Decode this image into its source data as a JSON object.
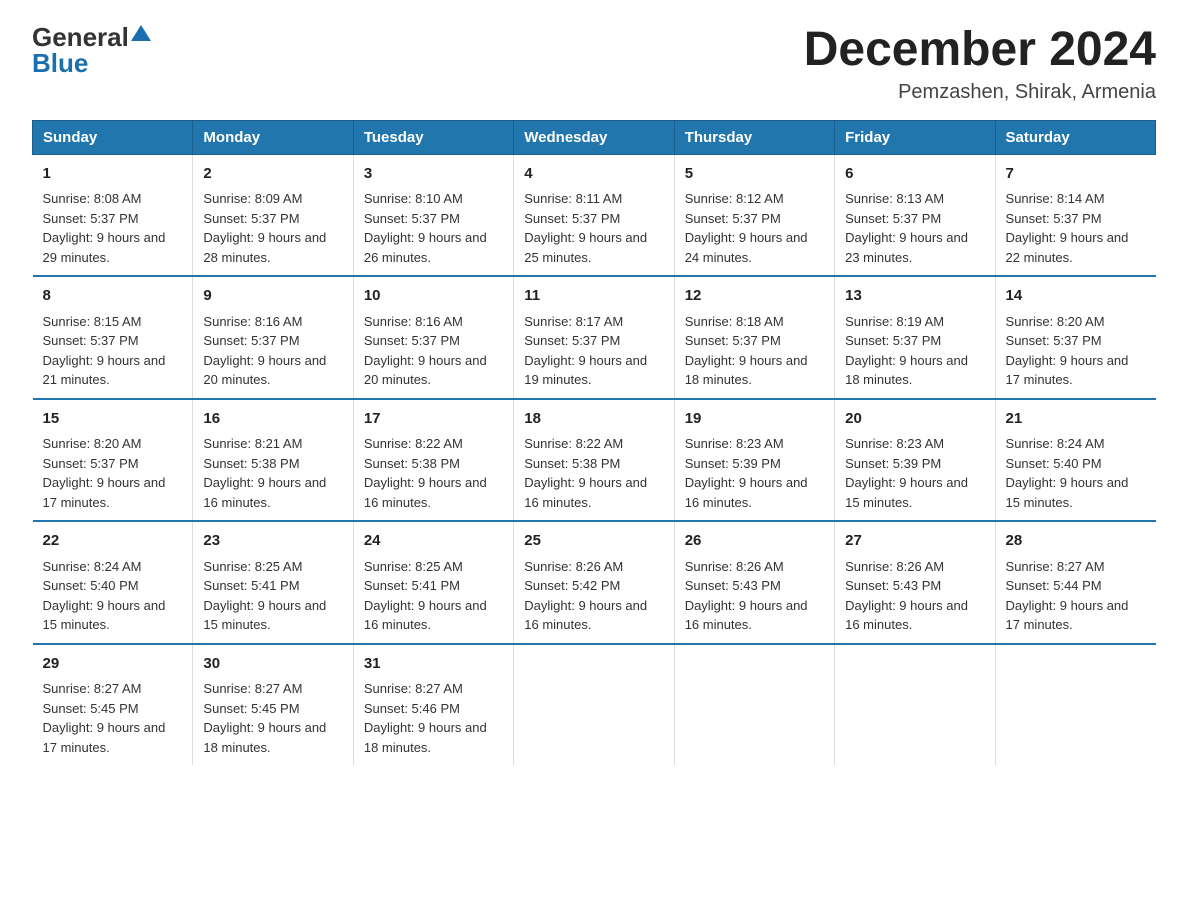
{
  "logo": {
    "general": "General",
    "blue": "Blue"
  },
  "title": "December 2024",
  "subtitle": "Pemzashen, Shirak, Armenia",
  "days_of_week": [
    "Sunday",
    "Monday",
    "Tuesday",
    "Wednesday",
    "Thursday",
    "Friday",
    "Saturday"
  ],
  "weeks": [
    [
      {
        "day": "1",
        "sunrise": "8:08 AM",
        "sunset": "5:37 PM",
        "daylight": "9 hours and 29 minutes."
      },
      {
        "day": "2",
        "sunrise": "8:09 AM",
        "sunset": "5:37 PM",
        "daylight": "9 hours and 28 minutes."
      },
      {
        "day": "3",
        "sunrise": "8:10 AM",
        "sunset": "5:37 PM",
        "daylight": "9 hours and 26 minutes."
      },
      {
        "day": "4",
        "sunrise": "8:11 AM",
        "sunset": "5:37 PM",
        "daylight": "9 hours and 25 minutes."
      },
      {
        "day": "5",
        "sunrise": "8:12 AM",
        "sunset": "5:37 PM",
        "daylight": "9 hours and 24 minutes."
      },
      {
        "day": "6",
        "sunrise": "8:13 AM",
        "sunset": "5:37 PM",
        "daylight": "9 hours and 23 minutes."
      },
      {
        "day": "7",
        "sunrise": "8:14 AM",
        "sunset": "5:37 PM",
        "daylight": "9 hours and 22 minutes."
      }
    ],
    [
      {
        "day": "8",
        "sunrise": "8:15 AM",
        "sunset": "5:37 PM",
        "daylight": "9 hours and 21 minutes."
      },
      {
        "day": "9",
        "sunrise": "8:16 AM",
        "sunset": "5:37 PM",
        "daylight": "9 hours and 20 minutes."
      },
      {
        "day": "10",
        "sunrise": "8:16 AM",
        "sunset": "5:37 PM",
        "daylight": "9 hours and 20 minutes."
      },
      {
        "day": "11",
        "sunrise": "8:17 AM",
        "sunset": "5:37 PM",
        "daylight": "9 hours and 19 minutes."
      },
      {
        "day": "12",
        "sunrise": "8:18 AM",
        "sunset": "5:37 PM",
        "daylight": "9 hours and 18 minutes."
      },
      {
        "day": "13",
        "sunrise": "8:19 AM",
        "sunset": "5:37 PM",
        "daylight": "9 hours and 18 minutes."
      },
      {
        "day": "14",
        "sunrise": "8:20 AM",
        "sunset": "5:37 PM",
        "daylight": "9 hours and 17 minutes."
      }
    ],
    [
      {
        "day": "15",
        "sunrise": "8:20 AM",
        "sunset": "5:37 PM",
        "daylight": "9 hours and 17 minutes."
      },
      {
        "day": "16",
        "sunrise": "8:21 AM",
        "sunset": "5:38 PM",
        "daylight": "9 hours and 16 minutes."
      },
      {
        "day": "17",
        "sunrise": "8:22 AM",
        "sunset": "5:38 PM",
        "daylight": "9 hours and 16 minutes."
      },
      {
        "day": "18",
        "sunrise": "8:22 AM",
        "sunset": "5:38 PM",
        "daylight": "9 hours and 16 minutes."
      },
      {
        "day": "19",
        "sunrise": "8:23 AM",
        "sunset": "5:39 PM",
        "daylight": "9 hours and 16 minutes."
      },
      {
        "day": "20",
        "sunrise": "8:23 AM",
        "sunset": "5:39 PM",
        "daylight": "9 hours and 15 minutes."
      },
      {
        "day": "21",
        "sunrise": "8:24 AM",
        "sunset": "5:40 PM",
        "daylight": "9 hours and 15 minutes."
      }
    ],
    [
      {
        "day": "22",
        "sunrise": "8:24 AM",
        "sunset": "5:40 PM",
        "daylight": "9 hours and 15 minutes."
      },
      {
        "day": "23",
        "sunrise": "8:25 AM",
        "sunset": "5:41 PM",
        "daylight": "9 hours and 15 minutes."
      },
      {
        "day": "24",
        "sunrise": "8:25 AM",
        "sunset": "5:41 PM",
        "daylight": "9 hours and 16 minutes."
      },
      {
        "day": "25",
        "sunrise": "8:26 AM",
        "sunset": "5:42 PM",
        "daylight": "9 hours and 16 minutes."
      },
      {
        "day": "26",
        "sunrise": "8:26 AM",
        "sunset": "5:43 PM",
        "daylight": "9 hours and 16 minutes."
      },
      {
        "day": "27",
        "sunrise": "8:26 AM",
        "sunset": "5:43 PM",
        "daylight": "9 hours and 16 minutes."
      },
      {
        "day": "28",
        "sunrise": "8:27 AM",
        "sunset": "5:44 PM",
        "daylight": "9 hours and 17 minutes."
      }
    ],
    [
      {
        "day": "29",
        "sunrise": "8:27 AM",
        "sunset": "5:45 PM",
        "daylight": "9 hours and 17 minutes."
      },
      {
        "day": "30",
        "sunrise": "8:27 AM",
        "sunset": "5:45 PM",
        "daylight": "9 hours and 18 minutes."
      },
      {
        "day": "31",
        "sunrise": "8:27 AM",
        "sunset": "5:46 PM",
        "daylight": "9 hours and 18 minutes."
      },
      {
        "day": "",
        "sunrise": "",
        "sunset": "",
        "daylight": ""
      },
      {
        "day": "",
        "sunrise": "",
        "sunset": "",
        "daylight": ""
      },
      {
        "day": "",
        "sunrise": "",
        "sunset": "",
        "daylight": ""
      },
      {
        "day": "",
        "sunrise": "",
        "sunset": "",
        "daylight": ""
      }
    ]
  ]
}
